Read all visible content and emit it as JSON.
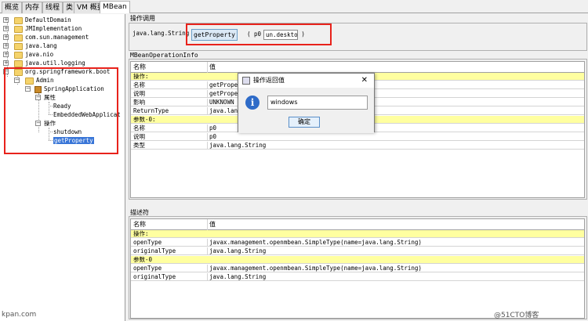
{
  "tabs": [
    {
      "label": "概览"
    },
    {
      "label": "内存"
    },
    {
      "label": "线程"
    },
    {
      "label": "类"
    },
    {
      "label": "VM 概要"
    },
    {
      "label": "MBean"
    }
  ],
  "tree": {
    "domains": [
      {
        "label": "DefaultDomain"
      },
      {
        "label": "JMImplementation"
      },
      {
        "label": "com.sun.management"
      },
      {
        "label": "java.lang"
      },
      {
        "label": "java.nio"
      },
      {
        "label": "java.util.logging"
      },
      {
        "label": "org.springframework.boot"
      }
    ],
    "admin": "Admin",
    "app": "SpringApplication",
    "attributes_label": "属性",
    "attributes": [
      {
        "label": "Ready"
      },
      {
        "label": "EmbeddedWebApplicat"
      }
    ],
    "operations_label": "操作",
    "operations": [
      {
        "label": "shutdown"
      },
      {
        "label": "getProperty"
      }
    ]
  },
  "invoke": {
    "section_label": "操作调用",
    "return_type": "java.lang.String",
    "button_label": "getProperty",
    "open_paren": "(",
    "param_name": "p0",
    "param_value": "un.desktop",
    "close_paren": ")"
  },
  "info": {
    "section_label": "MBeanOperationInfo",
    "headers": {
      "name": "名称",
      "value": "值"
    },
    "rows": [
      {
        "name": "操作:",
        "value": "",
        "yellow": true
      },
      {
        "name": "名称",
        "value": "getPropert",
        "yellow": false
      },
      {
        "name": "说明",
        "value": "getPropert",
        "yellow": false
      },
      {
        "name": "影响",
        "value": "UNKNOWN",
        "yellow": false
      },
      {
        "name": "ReturnType",
        "value": "java.lang.",
        "yellow": false
      },
      {
        "name": "参数-0:",
        "value": "",
        "yellow": true
      },
      {
        "name": "名称",
        "value": "p0",
        "yellow": false
      },
      {
        "name": "说明",
        "value": "p0",
        "yellow": false
      },
      {
        "name": "类型",
        "value": "java.lang.String",
        "yellow": false
      }
    ]
  },
  "descriptor": {
    "section_label": "描述符",
    "headers": {
      "name": "名称",
      "value": "值"
    },
    "rows": [
      {
        "name": "操作:",
        "value": "",
        "yellow": true
      },
      {
        "name": "openType",
        "value": "javax.management.openmbean.SimpleType(name=java.lang.String)",
        "yellow": false
      },
      {
        "name": "originalType",
        "value": "java.lang.String",
        "yellow": false
      },
      {
        "name": "参数-0",
        "value": "",
        "yellow": true
      },
      {
        "name": "openType",
        "value": "javax.management.openmbean.SimpleType(name=java.lang.String)",
        "yellow": false
      },
      {
        "name": "originalType",
        "value": "java.lang.String",
        "yellow": false
      }
    ]
  },
  "dialog": {
    "title": "操作返回值",
    "close": "✕",
    "icon_letter": "i",
    "value": "windows",
    "ok_label": "确定"
  },
  "watermarks": {
    "left": "kpan.com",
    "right": "@51CTO博客"
  },
  "colors": {
    "highlight_red": "#e8221b",
    "selection_blue": "#3875d7",
    "row_yellow": "#ffffa0"
  }
}
